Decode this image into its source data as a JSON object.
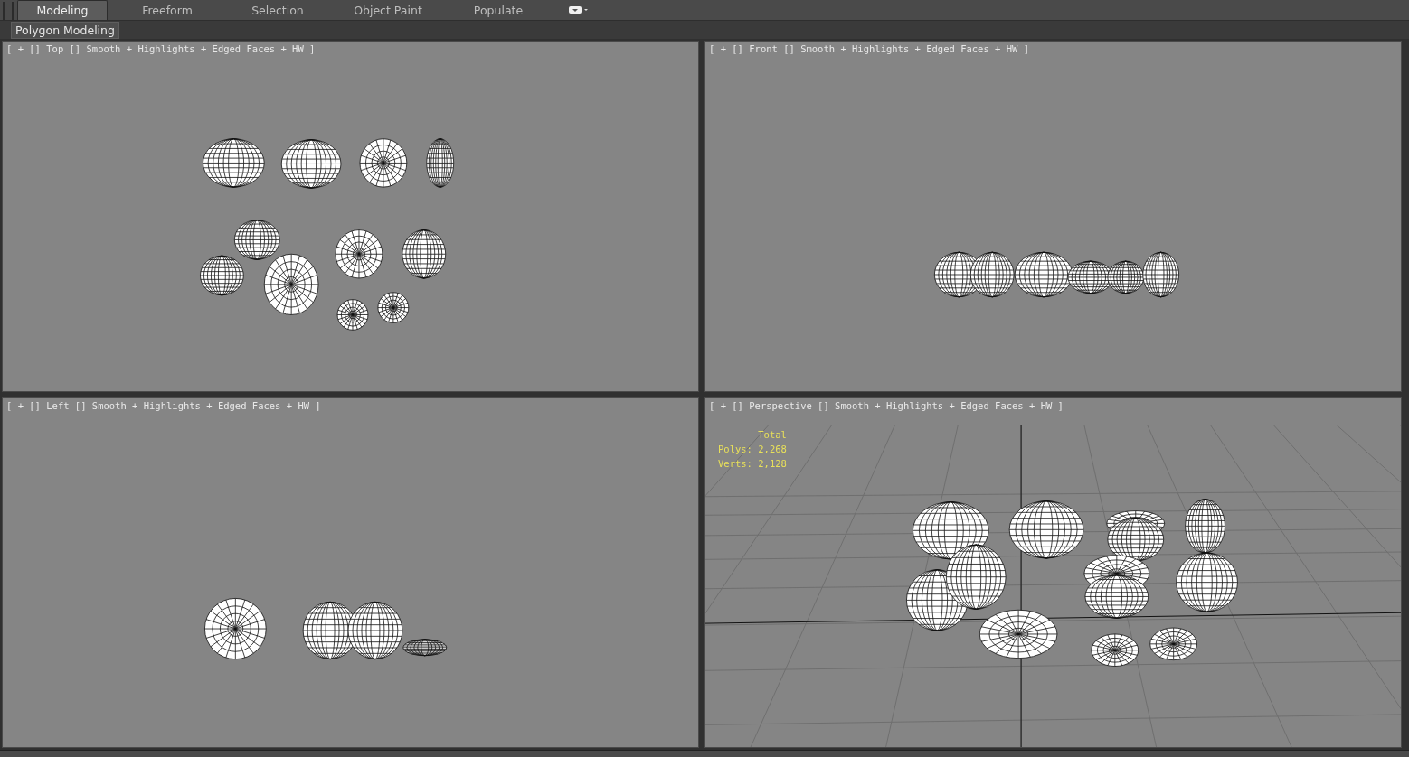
{
  "tabs": [
    {
      "label": "Modeling",
      "selected": true
    },
    {
      "label": "Freeform",
      "selected": false
    },
    {
      "label": "Selection",
      "selected": false
    },
    {
      "label": "Object Paint",
      "selected": false
    },
    {
      "label": "Populate",
      "selected": false
    }
  ],
  "ribbon_panel": {
    "label": "Polygon Modeling"
  },
  "viewports": [
    {
      "kind": "top",
      "label": "[ + [] Top [] Smooth + Highlights + Edged Faces + HW ]"
    },
    {
      "kind": "front",
      "label": "[ + [] Front [] Smooth + Highlights + Edged Faces + HW ]"
    },
    {
      "kind": "left",
      "label": "[ + [] Left [] Smooth + Highlights + Edged Faces + HW ]"
    },
    {
      "kind": "perspective",
      "label": "[ + [] Perspective [] Smooth + Highlights + Edged Faces + HW ]",
      "stats": {
        "heading": "Total",
        "rows": [
          "Polys: 2,268",
          "Verts: 2,128"
        ]
      }
    }
  ]
}
